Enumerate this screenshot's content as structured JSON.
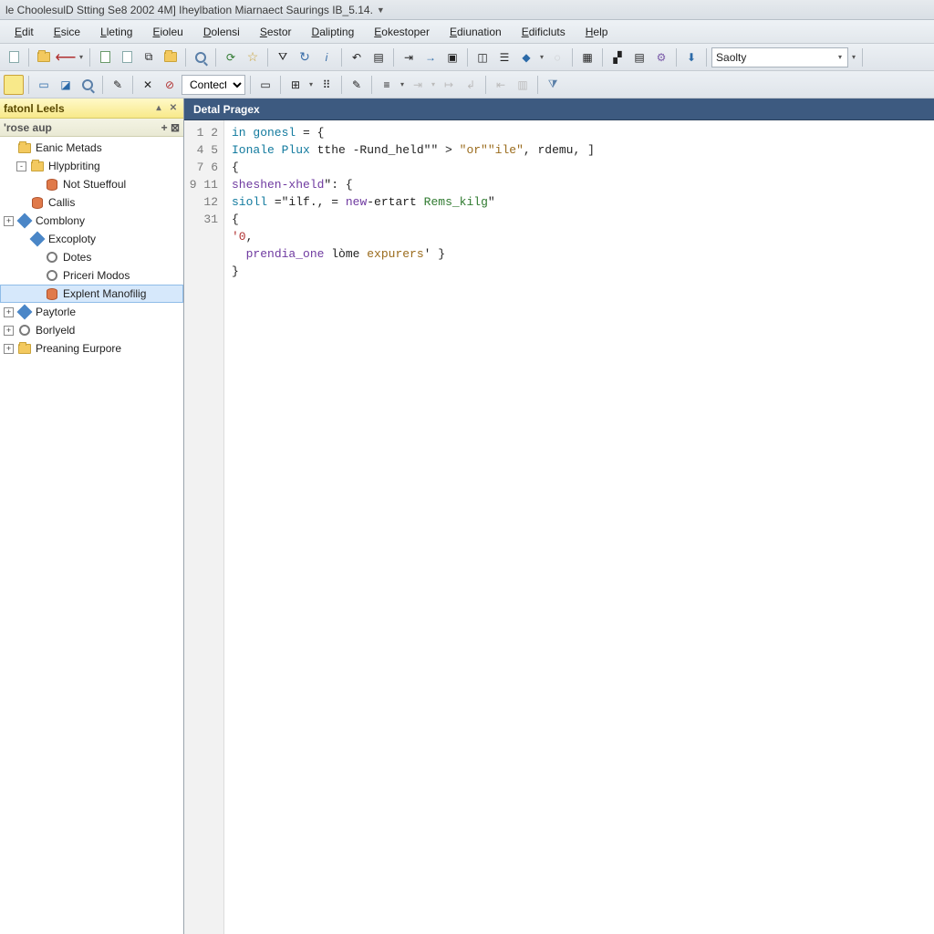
{
  "title": "le ChoolesulD Stting Se8 2002 4M] Iheylbation Miarnaect Saurings IB_5.14.",
  "menu": [
    "Edit",
    "Esice",
    "Lleting",
    "Eioleu",
    "Dolensi",
    "Sestor",
    "Dalipting",
    "Eokestoper",
    "Ediunation",
    "Edificluts",
    "Help"
  ],
  "toolbar1_combo": "Saolty",
  "toolbar2_combo": "Contect",
  "panel": {
    "title": "fatonl Leels",
    "sub": "'rose aup",
    "tree": [
      {
        "d": 0,
        "tw": "",
        "ico": "folder",
        "label": "Eanic Metads"
      },
      {
        "d": 1,
        "tw": "-",
        "ico": "folder",
        "label": "Hlypbriting"
      },
      {
        "d": 2,
        "tw": "",
        "ico": "db",
        "label": "Not Stueffoul"
      },
      {
        "d": 1,
        "tw": "",
        "ico": "db",
        "label": "Callis"
      },
      {
        "d": 0,
        "tw": "+",
        "ico": "cube",
        "label": "Comblony"
      },
      {
        "d": 1,
        "tw": "",
        "ico": "cube",
        "label": "Excoploty"
      },
      {
        "d": 2,
        "tw": "",
        "ico": "gear",
        "label": "Dotes"
      },
      {
        "d": 2,
        "tw": "",
        "ico": "gear",
        "label": "Priceri Modos"
      },
      {
        "d": 2,
        "tw": "",
        "ico": "db",
        "label": "Explent Manofilig",
        "sel": true
      },
      {
        "d": 0,
        "tw": "+",
        "ico": "cube",
        "label": "Paytorle"
      },
      {
        "d": 0,
        "tw": "+",
        "ico": "gear",
        "label": "Borlyeld"
      },
      {
        "d": 0,
        "tw": "+",
        "ico": "folder",
        "label": "Preaning Eurpore"
      }
    ]
  },
  "editorTab": "Detal Pragex",
  "code": {
    "lineNums": [
      "1",
      "2",
      "4",
      "5",
      "7",
      "6",
      "9",
      "11",
      "12",
      "31"
    ],
    "lines": [
      [
        {
          "c": "kw",
          "t": "in "
        },
        {
          "c": "kw",
          "t": "gonesl"
        },
        {
          "c": "pl",
          "t": " = {"
        }
      ],
      [
        {
          "c": "kw",
          "t": "Ionale Plux"
        },
        {
          "c": "pl",
          "t": " tthe -Rund_held\"\" > "
        },
        {
          "c": "str",
          "t": "\"or\"\"ile\""
        },
        {
          "c": "pl",
          "t": ", rdemu, ]"
        }
      ],
      [
        {
          "c": "pl",
          "t": "{"
        }
      ],
      [
        {
          "c": "kw2",
          "t": "sheshen-xheld"
        },
        {
          "c": "pl",
          "t": "\": {"
        }
      ],
      [
        {
          "c": "kw",
          "t": "sioll"
        },
        {
          "c": "pl",
          "t": " =\"ilf., = "
        },
        {
          "c": "kw2",
          "t": "new"
        },
        {
          "c": "pl",
          "t": "-ertart "
        },
        {
          "c": "str2",
          "t": "Rems_kilg"
        },
        {
          "c": "pl",
          "t": "\""
        }
      ],
      [
        {
          "c": "pl",
          "t": "{"
        }
      ],
      [
        {
          "c": "num",
          "t": "'0"
        },
        {
          "c": "pl",
          "t": ","
        }
      ],
      [
        {
          "c": "pl",
          "t": "  "
        },
        {
          "c": "kw2",
          "t": "prendia_one"
        },
        {
          "c": "pl",
          "t": " lòme "
        },
        {
          "c": "str",
          "t": "expurers"
        },
        {
          "c": "pl",
          "t": "' }"
        }
      ],
      [
        {
          "c": "pl",
          "t": "}"
        }
      ],
      [
        {
          "c": "pl",
          "t": ""
        }
      ]
    ]
  }
}
